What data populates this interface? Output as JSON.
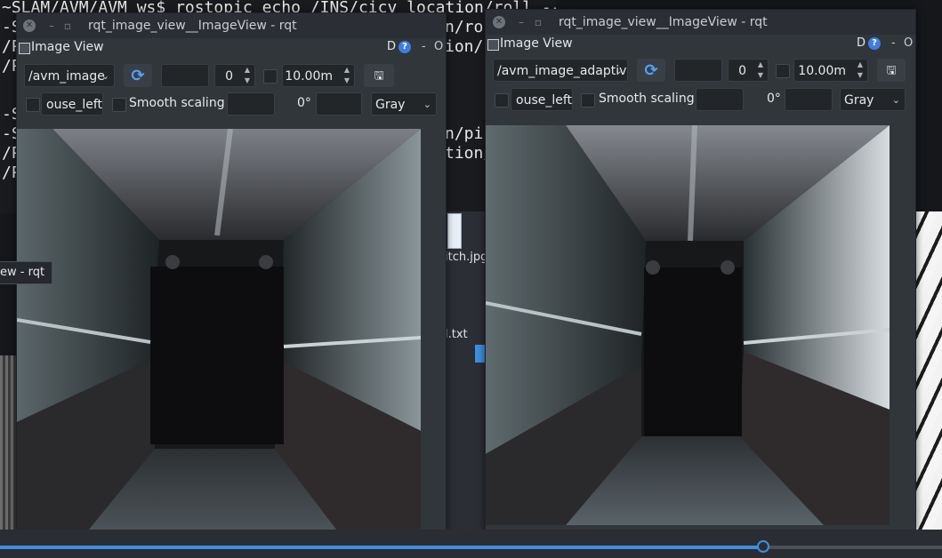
{
  "terminal": {
    "lines_left": [
      "~SLAM/AVM/AVM_ws$ rostopic echo /INS/cicv_location/roll --so",
      "-S",
      "/P",
      "/P",
      "",
      "",
      "-S",
      "-S",
      "/P",
      "/P"
    ],
    "lines_right": [
      "n/ro",
      "ion/",
      "n/pi",
      "tion/"
    ]
  },
  "file_manager": {
    "files": [
      "itch.jpg",
      "l.txt"
    ]
  },
  "tooltip": {
    "text": "ew - rqt"
  },
  "windows": [
    {
      "title": "rqt_image_view__ImageView - rqt",
      "dock_title": "Image View",
      "dock_d": "D",
      "dock_help": "?",
      "dock_dash": "-",
      "dock_o": "O",
      "topic": "/avm_image",
      "spin_value": "0",
      "duration": "10.00m",
      "mouse_topic": "ouse_left",
      "smooth_label": "Smooth scaling",
      "rotation": "0°",
      "colormap": "Gray"
    },
    {
      "title": "rqt_image_view__ImageView - rqt",
      "dock_title": "Image View",
      "dock_d": "D",
      "dock_help": "?",
      "dock_dash": "-",
      "dock_o": "O",
      "topic": "/avm_image_adaptiv",
      "spin_value": "0",
      "duration": "10.00m",
      "mouse_topic": "ouse_left",
      "smooth_label": "Smooth scaling",
      "rotation": "0°",
      "colormap": "Gray"
    }
  ],
  "icons": {
    "refresh": "refresh-icon",
    "save": "save-icon",
    "close": "close-icon"
  },
  "slider": {
    "progress": 0.81
  },
  "colors": {
    "accent": "#3d8fe0",
    "window_bg": "#31363b"
  }
}
